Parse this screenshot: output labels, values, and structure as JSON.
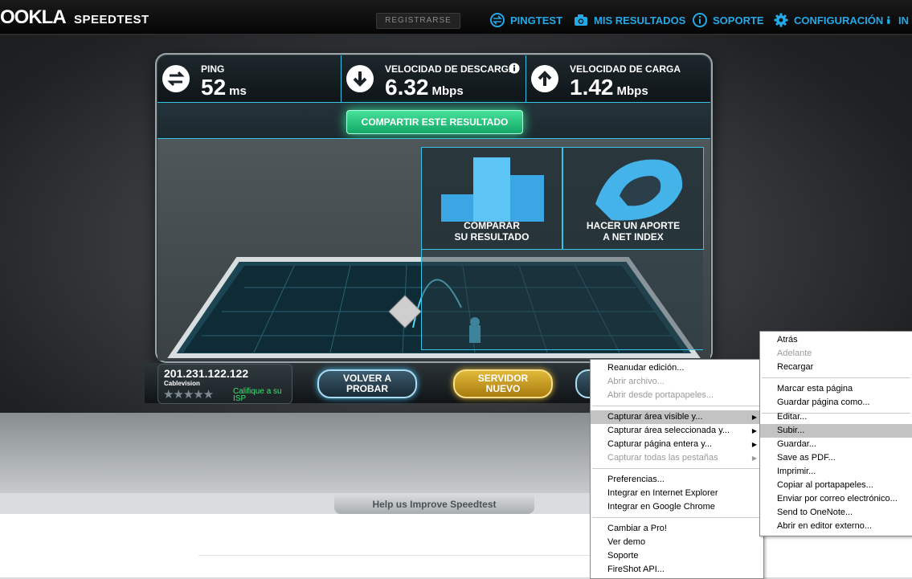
{
  "topbar": {
    "logo": "OOKLA",
    "logo_sub": "SPEEDTEST",
    "register": "REGISTRARSE",
    "nav": [
      "PINGTEST",
      "MIS RESULTADOS",
      "SOPORTE",
      "CONFIGURACIÓN",
      "IN"
    ]
  },
  "stats": {
    "ping": {
      "label": "PING",
      "value": "52",
      "unit": "ms"
    },
    "download": {
      "label": "VELOCIDAD DE DESCARGA",
      "value": "6.32",
      "unit": "Mbps"
    },
    "upload": {
      "label": "VELOCIDAD DE CARGA",
      "value": "1.42",
      "unit": "Mbps"
    }
  },
  "share_button": "COMPARTIR ESTE RESULTADO",
  "tiles": {
    "compare": {
      "line1": "COMPARAR",
      "line2": "SU RESULTADO"
    },
    "netindex": {
      "line1": "HACER UN APORTE",
      "line2": "A NET INDEX"
    }
  },
  "footer_panel": {
    "ip": "201.231.122.122",
    "isp": "Cablevision",
    "stars": "★★★★★",
    "rate_isp": "Califique a su ISP",
    "retest": {
      "line1": "VOLVER A",
      "line2": "PROBAR"
    },
    "new_server": {
      "line1": "SERVIDOR",
      "line2": "NUEVO"
    }
  },
  "help_button": "Help us Improve Speedtest",
  "colors": {
    "accent": "#24a9e8",
    "cyan": "#36c4e6",
    "green": "#12a866",
    "gold": "#d7a51c"
  },
  "menu_left": {
    "items": [
      {
        "label": "Reanudar edición...",
        "disabled": false
      },
      {
        "label": "Abrir archivo...",
        "disabled": true
      },
      {
        "label": "Abrir desde portapapeles...",
        "disabled": true
      },
      {
        "label": "Capturar área visible y...",
        "disabled": false,
        "submenu": true,
        "highlight": true
      },
      {
        "label": "Capturar área seleccionada y...",
        "disabled": false,
        "submenu": true
      },
      {
        "label": "Capturar página entera y...",
        "disabled": false,
        "submenu": true
      },
      {
        "label": "Capturar todas las pestañas",
        "disabled": true,
        "submenu": true
      },
      {
        "label": "Preferencias...",
        "disabled": false
      },
      {
        "label": "Integrar en Internet Explorer",
        "disabled": false
      },
      {
        "label": "Integrar en Google Chrome",
        "disabled": false
      },
      {
        "label": "Cambiar a Pro!",
        "disabled": false
      },
      {
        "label": "Ver demo",
        "disabled": false
      },
      {
        "label": "Soporte",
        "disabled": false
      },
      {
        "label": "FireShot API...",
        "disabled": false
      }
    ]
  },
  "menu_right": {
    "items": [
      {
        "label": "Atrás",
        "disabled": false
      },
      {
        "label": "Adelante",
        "disabled": true
      },
      {
        "label": "Recargar",
        "disabled": false
      },
      {
        "label": "Marcar esta página",
        "disabled": false
      },
      {
        "label": "Guardar página como...",
        "disabled": false
      },
      {
        "label": "Editar...",
        "disabled": false
      },
      {
        "label": "Subir...",
        "disabled": false,
        "highlight": true
      },
      {
        "label": "Guardar...",
        "disabled": false
      },
      {
        "label": "Save as PDF...",
        "disabled": false
      },
      {
        "label": "Imprimir...",
        "disabled": false
      },
      {
        "label": "Copiar al portapapeles...",
        "disabled": false
      },
      {
        "label": "Enviar por correo electrónico...",
        "disabled": false
      },
      {
        "label": "Send to OneNote...",
        "disabled": false
      },
      {
        "label": "Abrir en editor externo...",
        "disabled": false
      }
    ]
  }
}
